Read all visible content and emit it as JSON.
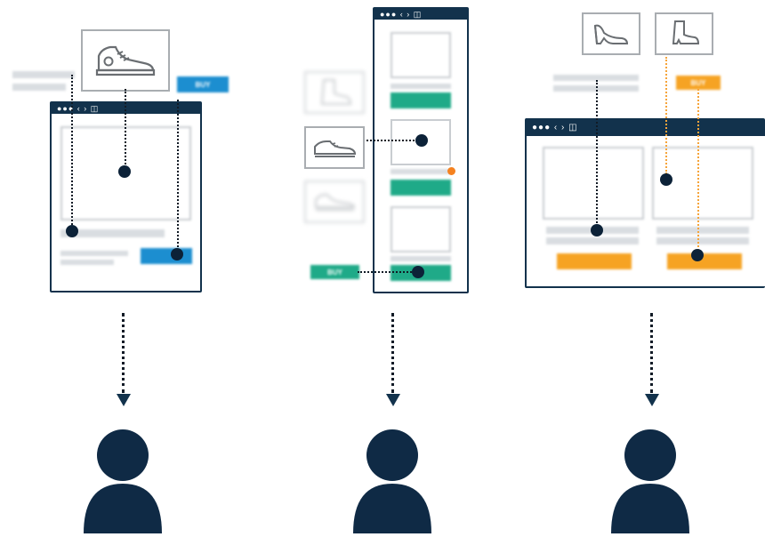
{
  "colors": {
    "navy": "#12324c",
    "blue_button": "#1c8ed0",
    "teal_button": "#1faa88",
    "orange_button": "#f6a323",
    "notification_dot": "#f58220",
    "gray_bar": "#d9dde1"
  },
  "window_controls": "●●● ‹ › ◫",
  "scenario_1": {
    "buy_label": "BUY",
    "product_icon": "sneaker-icon"
  },
  "scenario_2": {
    "buy_label": "BUY",
    "product_icons": [
      "boot-icon",
      "dress-shoe-icon",
      "sneaker-icon"
    ]
  },
  "scenario_3": {
    "buy_label": "BUY",
    "product_icons": [
      "high-heel-icon",
      "ankle-boot-icon"
    ]
  },
  "users": [
    "user-icon",
    "user-icon",
    "user-icon"
  ]
}
